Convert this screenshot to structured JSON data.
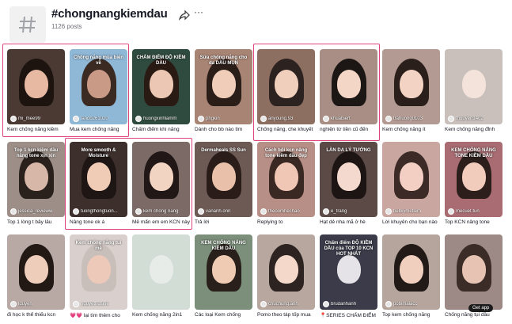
{
  "header": {
    "title": "#chongnangkiemdau",
    "count": "1126 posts"
  },
  "colors": {
    "highlight": "#e0447f"
  },
  "cards": [
    {
      "user": "mi_mee99",
      "caption": "Kem chống nắng kiềm",
      "overlay": "",
      "bg": "#4b3a34",
      "face": "#e7b9a2",
      "hair": "#1d1410"
    },
    {
      "user": "lando261020",
      "caption": "Mua kem chống nắng",
      "overlay": "Chống nắng mùa biển về",
      "bg": "#8fb7d6",
      "face": "#c99a86",
      "hair": "#3a2a22"
    },
    {
      "user": "huongxinhlamm",
      "caption": "Chấm điểm khi nắng",
      "overlay": "CHẤM ĐIỂM ĐỘ KIỀM DẦU",
      "bg": "#2f4a3f",
      "face": "#ecc8b4",
      "hair": "#2a1a14"
    },
    {
      "user": "phgkin",
      "caption": "Dành cho bb nào tìm",
      "overlay": "Sữa chống nắng cho da DẦU MỤN",
      "bg": "#a88474",
      "face": "#f0cdb9",
      "hair": "#2b1d18"
    },
    {
      "user": "anyoung.93",
      "caption": "Chống nắng, che khuyết",
      "overlay": "",
      "bg": "#8d6f62",
      "face": "#f1cfbd",
      "hair": "#2c2220"
    },
    {
      "user": "khuabiert",
      "caption": "nghiện từ tiền cũ đến",
      "overlay": "",
      "bg": "#a88e84",
      "face": "#f4d6c6",
      "hair": "#1c1614"
    },
    {
      "user": "trahuong0103",
      "caption": "Kem chống nắng ít",
      "overlay": "",
      "bg": "#b39a92",
      "face": "#f2d3c4",
      "hair": "#2a1f1b"
    },
    {
      "user": "thuuyen1402",
      "caption": "Kem chống nắng đỉnh",
      "overlay": "",
      "bg": "#c9c0bc",
      "face": "#f3e3da",
      "hair": "#c9c0bc"
    },
    {
      "user": "jessica_revieww",
      "caption": "Top 1 lòng t bây lâu",
      "overlay": "Top 1 kcn kiềm dầu nâng tone xịn xịn",
      "bg": "#9d8f88",
      "face": "#d7b7a8",
      "hair": "#2a211d"
    },
    {
      "user": "tuongthongtuon...",
      "caption": "Nâng tone ok á",
      "overlay": "More smooth & Moisture",
      "bg": "#3d2f2c",
      "face": "#f0ccb7",
      "hair": "#1e1614"
    },
    {
      "user": "kem chống nắng",
      "caption": "Mê mẩn em em KCN này",
      "overlay": "",
      "bg": "#7c6a66",
      "face": "#f2d4c3",
      "hair": "#201716"
    },
    {
      "user": "vananh.onn",
      "caption": "Trả lời",
      "overlay": "Dermaheals SS Sun",
      "bg": "#6d5a55",
      "face": "#e9c1ab",
      "hair": "#2a1d19"
    },
    {
      "user": "theoomhechao",
      "caption": "Replying to",
      "overlay": "Cách bôi kcn nâng tone kiềm dầu đẹp",
      "bg": "#b78f86",
      "face": "#f0c6b4",
      "hair": "#3a2822"
    },
    {
      "user": "e_trang",
      "caption": "Hạt dẻ nha mã ở hè",
      "overlay": "LÀN DA LÝ TƯỞNG",
      "bg": "#5c4a46",
      "face": "#f4dace",
      "hair": "#1d1513"
    },
    {
      "user": "bellkymetlem",
      "caption": "Lời khuyên cho bạn nào",
      "overlay": "",
      "bg": "#caa6a0",
      "face": "#f2cfc2",
      "hair": "#3b2a26"
    },
    {
      "user": "mecuet.tun",
      "caption": "Top KCN nâng tone",
      "overlay": "KEM CHỐNG NẮNG TONE KIỀM DẦU",
      "bg": "#a86c72",
      "face": "#f1cbbb",
      "hair": "#2b1e1b"
    },
    {
      "user": "lduyen",
      "caption": "đi học k thể thiếu kcn",
      "overlay": "",
      "bg": "#b8a9a4",
      "face": "#efcdbb",
      "hair": "#221915"
    },
    {
      "user": "nguyethusine",
      "caption": "💗💗 lại tìm thêm cho",
      "overlay": "Kem chống nắng tui mê",
      "bg": "#d9d0cd",
      "face": "#ecc9b8",
      "hair": "#c9bfba"
    },
    {
      "user": "",
      "caption": "Kem chống nắng 2in1",
      "overlay": "",
      "bg": "#d2ddd6",
      "face": "#e8ece9",
      "hair": "#d2ddd6"
    },
    {
      "user": "",
      "caption": "Các loại Kem chống",
      "overlay": "KEM CHỐNG NẮNG KIỀM DẦU",
      "bg": "#7b8f7a",
      "face": "#efcbb4",
      "hair": "#2a201b"
    },
    {
      "user": "chuchung.anh",
      "caption": "Pomo theo táp tốp mua",
      "overlay": "",
      "bg": "#b7a79f",
      "face": "#f4d8c9",
      "hair": "#2d2320"
    },
    {
      "user": "brudanhanh",
      "caption": "📍SERIES CHẤM ĐIỂM",
      "overlay": "Chấm điểm ĐỘ KIỀM DẦU của TOP 10 KCN HOT NHẤT",
      "bg": "#3b3b4a",
      "face": "#e6e3e8",
      "hair": "#3b3b4a"
    },
    {
      "user": "pobimalacc",
      "caption": "Top kem chống nắng",
      "overlay": "",
      "bg": "#b6a59d",
      "face": "#f0cfbf",
      "hair": "#221a17"
    },
    {
      "user": "",
      "caption": "Chống nắng tụi dầu",
      "overlay": "",
      "bg": "#9d8985",
      "face": "#e6c3b2",
      "hair": "#3b2c27"
    }
  ],
  "badge": "Get app"
}
